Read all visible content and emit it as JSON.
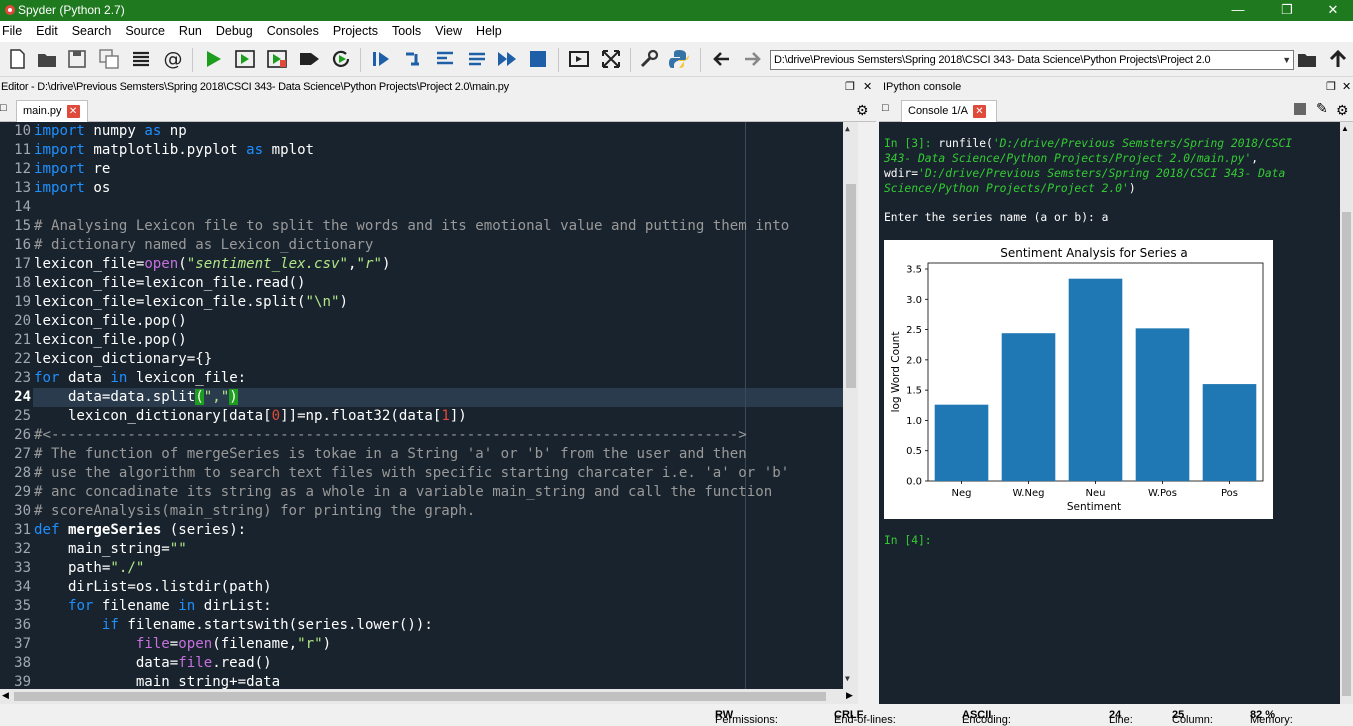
{
  "window": {
    "title": "Spyder (Python 2.7)"
  },
  "menu": [
    "File",
    "Edit",
    "Search",
    "Source",
    "Run",
    "Debug",
    "Consoles",
    "Projects",
    "Tools",
    "View",
    "Help"
  ],
  "toolbar": {
    "path": "D:\\drive\\Previous Semsters\\Spring 2018\\CSCI 343- Data Science\\Python Projects\\Project 2.0"
  },
  "editor": {
    "header": "Editor - D:\\drive\\Previous Semsters\\Spring 2018\\CSCI 343- Data Science\\Python Projects\\Project 2.0\\main.py",
    "tab": "main.py",
    "current_line": 24,
    "lines": [
      {
        "n": "10"
      },
      {
        "n": "11"
      },
      {
        "n": "12"
      },
      {
        "n": "13"
      },
      {
        "n": "14"
      },
      {
        "n": "15"
      },
      {
        "n": "16"
      },
      {
        "n": "17"
      },
      {
        "n": "18"
      },
      {
        "n": "19"
      },
      {
        "n": "20"
      },
      {
        "n": "21"
      },
      {
        "n": "22"
      },
      {
        "n": "23"
      },
      {
        "n": "24"
      },
      {
        "n": "25"
      },
      {
        "n": "26"
      },
      {
        "n": "27"
      },
      {
        "n": "28"
      },
      {
        "n": "29"
      },
      {
        "n": "30"
      },
      {
        "n": "31"
      },
      {
        "n": "32"
      },
      {
        "n": "33"
      },
      {
        "n": "34"
      },
      {
        "n": "35"
      },
      {
        "n": "36"
      },
      {
        "n": "37"
      },
      {
        "n": "38"
      },
      {
        "n": "39"
      }
    ],
    "code": {
      "l10a": "import",
      "l10b": " numpy ",
      "l10c": "as",
      "l10d": " np",
      "l11a": "import",
      "l11b": " matplotlib.pyplot ",
      "l11c": "as",
      "l11d": " mplot",
      "l12a": "import",
      "l12b": " re",
      "l13a": "import",
      "l13b": " os",
      "l15": "# Analysing Lexicon file to split the words and its emotional value and putting them into",
      "l16": "# dictionary named as Lexicon_dictionary",
      "l17a": "lexicon_file=",
      "l17b": "open",
      "l17c": "(",
      "l17d": "\"sentiment_lex.csv\"",
      "l17e": ",",
      "l17f": "\"r\"",
      "l17g": ")",
      "l18": "lexicon_file=lexicon_file.read()",
      "l19a": "lexicon_file=lexicon_file.split(",
      "l19b": "\"\\n\"",
      "l19c": ")",
      "l20": "lexicon_file.pop()",
      "l21": "lexicon_file.pop()",
      "l22": "lexicon_dictionary={}",
      "l23a": "for",
      "l23b": " data ",
      "l23c": "in",
      "l23d": " lexicon_file:",
      "l24a": "    data=data.split",
      "l24b": "(",
      "l24c": "\",\"",
      "l24d": ")",
      "l25a": "    lexicon_dictionary[data[",
      "l25b": "0",
      "l25c": "]]=np.float32(data[",
      "l25d": "1",
      "l25e": "])",
      "l26": "#<--------------------------------------------------------------------------------->",
      "l27": "# The function of mergeSeries is tokae in a String 'a' or 'b' from the user and then",
      "l28": "# use the algorithm to search text files with specific starting charcater i.e. 'a' or 'b'",
      "l29": "# anc concadinate its string as a whole in a variable main_string and call the function",
      "l30": "# scoreAnalysis(main_string) for printing the graph.",
      "l31a": "def",
      "l31b": " ",
      "l31c": "mergeSeries",
      "l31d": " (series):",
      "l32a": "    main_string=",
      "l32b": "\"\"",
      "l33a": "    path=",
      "l33b": "\"./\"",
      "l34": "    dirList=os.listdir(path)",
      "l35a": "    ",
      "l35b": "for",
      "l35c": " filename ",
      "l35d": "in",
      "l35e": " dirList:",
      "l36a": "        ",
      "l36b": "if",
      "l36c": " filename.startswith(series.lower()):",
      "l37a": "            ",
      "l37b": "file",
      "l37c": "=",
      "l37d": "open",
      "l37e": "(filename,",
      "l37f": "\"r\"",
      "l37g": ")",
      "l38a": "            data=",
      "l38b": "file",
      "l38c": ".read()",
      "l39": "            main_string+=data"
    }
  },
  "console": {
    "header": "IPython console",
    "tab": "Console 1/A",
    "in3_prompt": "In [3]: ",
    "in3_call": "runfile(",
    "in3_arg1": "'D:/drive/Previous Semsters/Spring 2018/CSCI",
    "in3_arg1b": "343- Data Science/Python Projects/Project 2.0/main.py'",
    "in3_sep": ",",
    "in3_wdir": "wdir=",
    "in3_arg2": "'D:/drive/Previous Semsters/Spring 2018/CSCI 343- Data",
    "in3_arg2b": "Science/Python Projects/Project 2.0'",
    "in3_close": ")",
    "prompt_out": "Enter the series name (a or b): a",
    "in4_prompt": "In [4]:"
  },
  "chart_data": {
    "type": "bar",
    "title": "Sentiment Analysis for Series a",
    "xlabel": "Sentiment",
    "ylabel": "log Word Count",
    "categories": [
      "Neg",
      "W.Neg",
      "Neu",
      "W.Pos",
      "Pos"
    ],
    "values": [
      1.26,
      2.44,
      3.34,
      2.52,
      1.6
    ],
    "ylim": [
      0,
      3.5
    ],
    "yticks": [
      "0.0",
      "0.5",
      "1.0",
      "1.5",
      "2.0",
      "2.5",
      "3.0",
      "3.5"
    ],
    "bar_color": "#1f77b4"
  },
  "status": {
    "permissions_label": "Permissions:",
    "permissions_value": "RW",
    "eol_label": "End-of-lines:",
    "eol_value": "CRLF",
    "encoding_label": "Encoding:",
    "encoding_value": "ASCII",
    "line_label": "Line:",
    "line_value": "24",
    "column_label": "Column:",
    "column_value": "25",
    "memory_label": "Memory:",
    "memory_value": "82 %"
  },
  "colors": {
    "title_bg": "#1f7a1f",
    "editor_bg": "#19232d",
    "keyword": "#c670e0",
    "string": "#b0e686",
    "comment": "#999999",
    "console_green": "#33cc33"
  }
}
